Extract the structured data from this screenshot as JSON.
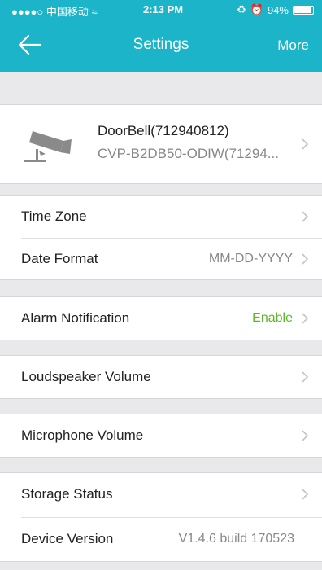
{
  "status_bar": {
    "carrier": "●●●●○ 中国移动 ",
    "time": "2:13 PM",
    "battery": "94%",
    "battery_level": 0.94
  },
  "nav": {
    "title": "Settings",
    "more": "More",
    "back_icon": "arrow-left-icon"
  },
  "device": {
    "name": "DoorBell(712940812)",
    "id": "CVP-B2DB50-ODIW(71294...",
    "icon": "camera-icon"
  },
  "settings": {
    "time_zone": {
      "label": "Time Zone"
    },
    "date_format": {
      "label": "Date Format",
      "value": "MM-DD-YYYY"
    },
    "alarm": {
      "label": "Alarm Notification",
      "value": "Enable",
      "value_color": "#5cb82a"
    },
    "loudspeaker": {
      "label": "Loudspeaker Volume"
    },
    "microphone": {
      "label": "Microphone Volume"
    },
    "storage": {
      "label": "Storage Status"
    },
    "version": {
      "label": "Device Version",
      "value": "V1.4.6 build 170523"
    }
  },
  "colors": {
    "accent": "#1cb4c8",
    "background": "#e9e9ec"
  }
}
